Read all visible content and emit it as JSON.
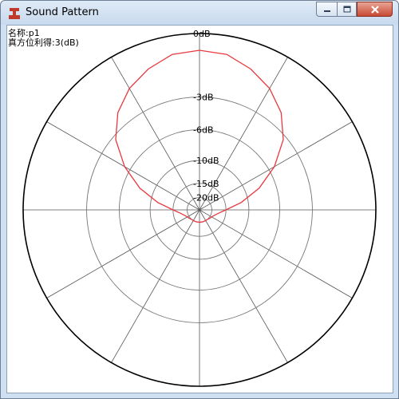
{
  "window": {
    "title": "Sound Pattern",
    "background_title": "",
    "colors": {
      "frame": "#cfe0f2",
      "close_button": "#c74a35",
      "app_icon": "#c0392b"
    }
  },
  "info": {
    "name_line": "名称:p1",
    "gain_line": "真方位利得:3(dB)"
  },
  "chart_data": {
    "type": "polar",
    "title": "",
    "radial_unit": "dB",
    "ring_labels": [
      "0dB",
      "-3dB",
      "-6dB",
      "-10dB",
      "-15dB",
      "-20dB"
    ],
    "ring_fractions": [
      1.0,
      0.64,
      0.455,
      0.28,
      0.15,
      0.07
    ],
    "spokes": 12,
    "series": [
      {
        "color": "#e8393f",
        "angles_deg": [
          0,
          10,
          20,
          30,
          40,
          50,
          60,
          70,
          80,
          90,
          100,
          110,
          120,
          130,
          140,
          150,
          160,
          170,
          180,
          190,
          200,
          210,
          220,
          230,
          240,
          250,
          260,
          270,
          280,
          290,
          300,
          310,
          320,
          330,
          340,
          350
        ],
        "radius_fraction": [
          0.905,
          0.895,
          0.85,
          0.795,
          0.72,
          0.62,
          0.49,
          0.36,
          0.24,
          0.15,
          0.11,
          0.09,
          0.08,
          0.075,
          0.07,
          0.07,
          0.07,
          0.07,
          0.07,
          0.07,
          0.07,
          0.07,
          0.07,
          0.075,
          0.08,
          0.09,
          0.11,
          0.15,
          0.24,
          0.36,
          0.49,
          0.62,
          0.72,
          0.795,
          0.85,
          0.895
        ]
      }
    ]
  }
}
